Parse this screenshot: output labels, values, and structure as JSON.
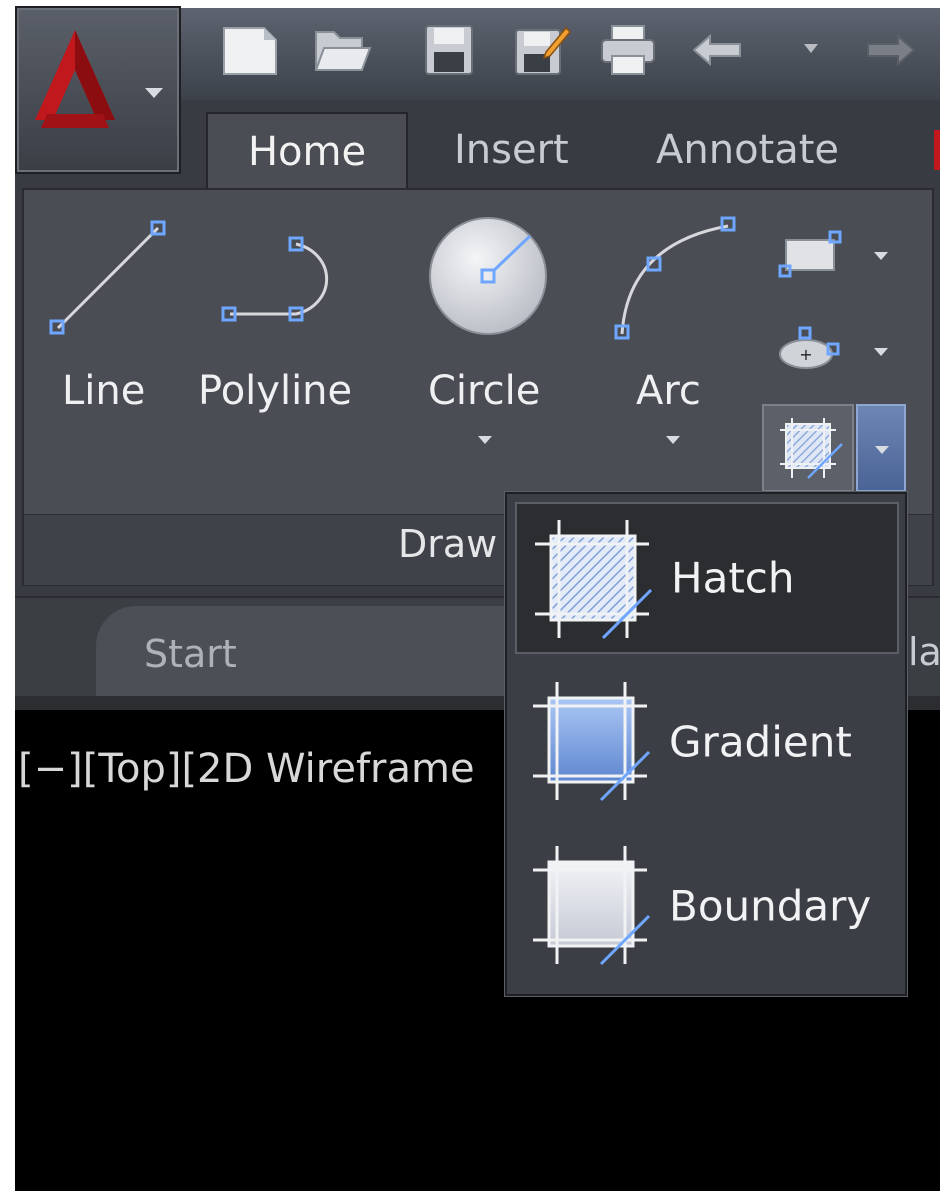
{
  "quick_access": {
    "icons": [
      "new-file-icon",
      "open-folder-icon",
      "save-icon",
      "save-as-icon",
      "print-icon",
      "undo-icon",
      "undo-dropdown-icon",
      "redo-icon"
    ]
  },
  "ribbon": {
    "tabs": [
      "Home",
      "Insert",
      "Annotate"
    ],
    "draw_panel": {
      "title": "Draw",
      "tools": [
        "Line",
        "Polyline",
        "Circle",
        "Arc"
      ]
    }
  },
  "file_tabs": {
    "start": "Start",
    "peek": "la"
  },
  "viewport": {
    "label": "[−][Top][2D Wireframe"
  },
  "hatch_menu": {
    "items": [
      "Hatch",
      "Gradient",
      "Boundary"
    ],
    "active": "Hatch"
  },
  "colors": {
    "accent_blue": "#6fa6ff",
    "autocad_red": "#c0181c"
  }
}
